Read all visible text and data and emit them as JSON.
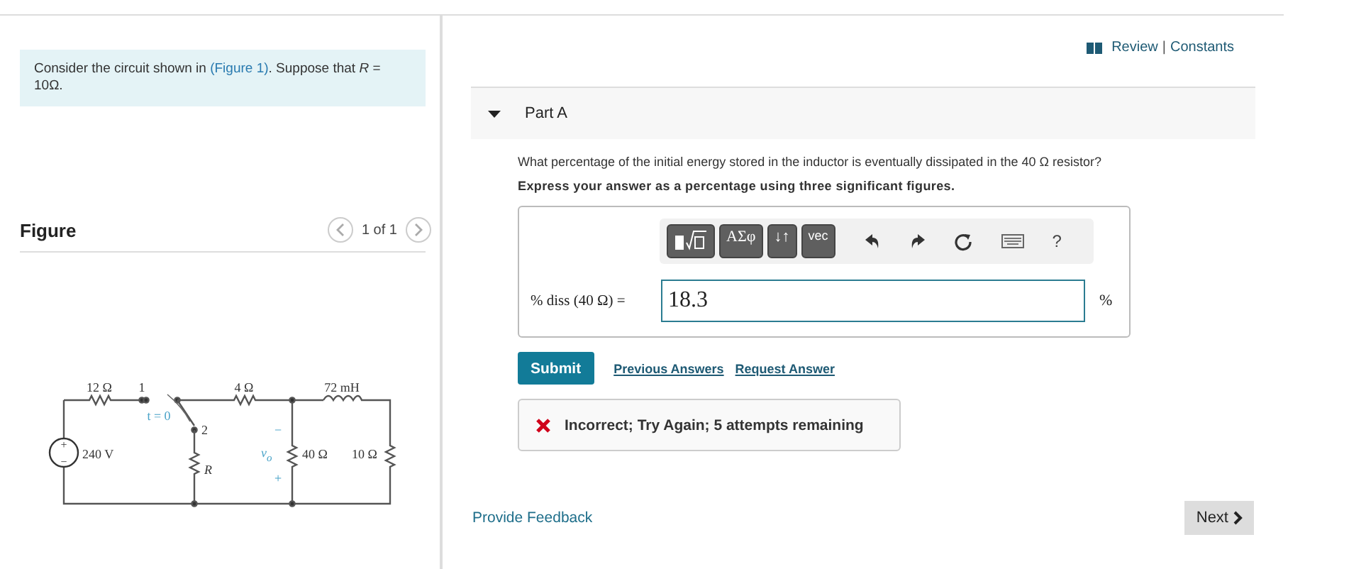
{
  "problem": {
    "before": "Consider the circuit shown in ",
    "link": "(Figure 1)",
    "after": ". Suppose that *R* = 10Ω."
  },
  "figure": {
    "title": "Figure",
    "pager": "1 of 1",
    "labels": {
      "r1": "12 Ω",
      "node1": "1",
      "switch_time": "t = 0",
      "node2": "2",
      "source": "240 V",
      "source_plus": "+",
      "source_minus": "−",
      "r_var": "R",
      "r2": "4 Ω",
      "inductor": "72 mH",
      "vo": "v$_{o}$",
      "vo_minus": "−",
      "vo_plus": "+",
      "r3": "40 Ω",
      "r4": "10 Ω"
    }
  },
  "header_links": [
    "Review",
    "Constants"
  ],
  "header_separator": "|",
  "part": {
    "title": "Part A",
    "expanded": true
  },
  "question": "What percentage of the initial energy stored in the inductor is eventually dissipated in the 40 Ω resistor?",
  "instruction": "Express your answer as a percentage using three significant figures.",
  "toolbar": [
    {
      "kind": "template"
    },
    {
      "kind": "text",
      "label": "ΑΣφ"
    },
    {
      "kind": "text",
      "label": "↓↑"
    },
    {
      "kind": "small",
      "label": "vec"
    }
  ],
  "tools": [
    {
      "kind": "undo"
    },
    {
      "kind": "redo"
    },
    {
      "kind": "reset"
    },
    {
      "kind": "keyboard"
    },
    {
      "kind": "help",
      "label": "?"
    }
  ],
  "answer": {
    "label": "% diss (40 Ω) =",
    "value": "18.3",
    "unit": "%"
  },
  "submit": "Submit",
  "answer_links": [
    "Previous Answers",
    "Request Answer"
  ],
  "feedback": {
    "correct": false,
    "text": "Incorrect; Try Again; 5 attempts remaining"
  },
  "footer": {
    "feedback_link": "Provide Feedback",
    "next": "Next"
  }
}
